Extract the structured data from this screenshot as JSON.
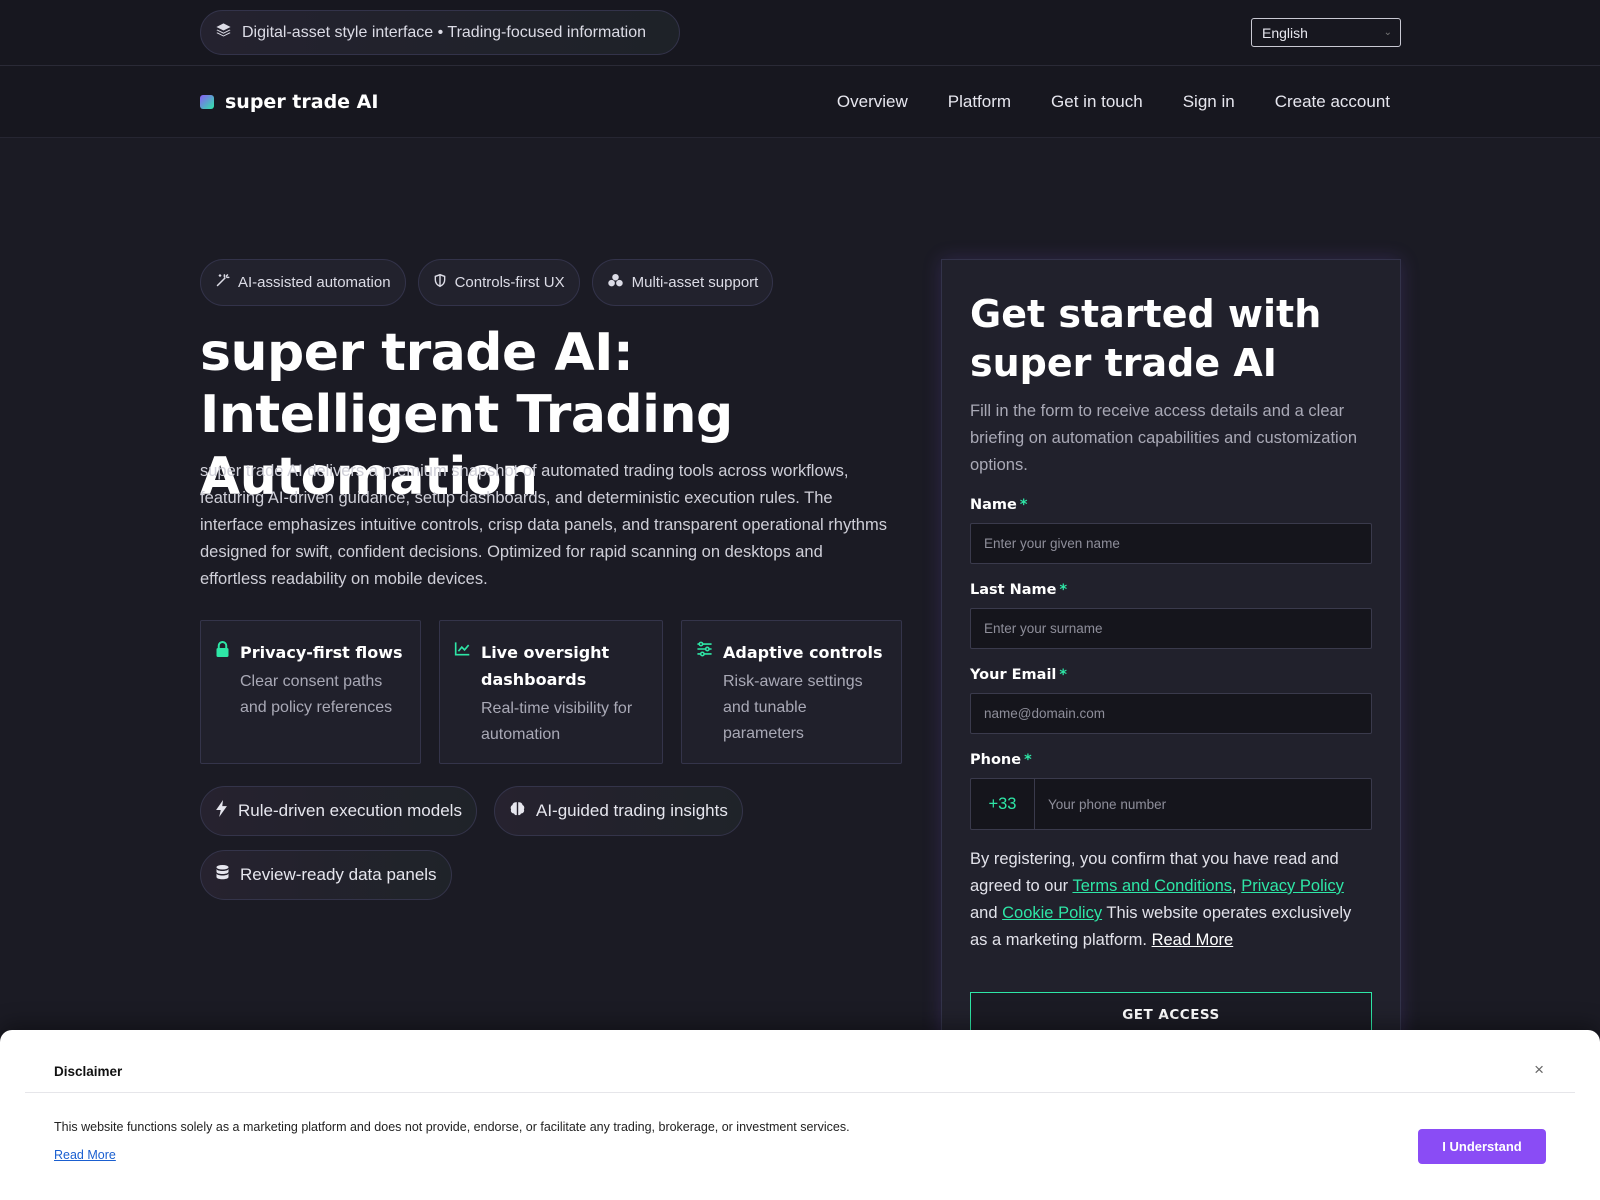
{
  "topbar": {
    "notice": "Digital-asset style interface • Trading-focused information",
    "language": "English"
  },
  "nav": {
    "brand": "super trade AI",
    "links": [
      "Overview",
      "Platform",
      "Get in touch",
      "Sign in",
      "Create account"
    ]
  },
  "hero": {
    "chips": [
      "AI-assisted automation",
      "Controls-first UX",
      "Multi-asset support"
    ],
    "title": "super trade AI: Intelligent Trading Automation",
    "description": "super trade AI delivers a premium snapshot of automated trading tools across workflows, featuring AI-driven guidance, setup dashboards, and deterministic execution rules. The interface emphasizes intuitive controls, crisp data panels, and transparent operational rhythms designed for swift, confident decisions. Optimized for rapid scanning on desktops and effortless readability on mobile devices.",
    "features": [
      {
        "title": "Privacy-first flows",
        "desc": "Clear consent paths and policy references",
        "icon": "lock-icon"
      },
      {
        "title": "Live oversight dashboards",
        "desc": "Real-time visibility for automation",
        "icon": "line-chart-icon"
      },
      {
        "title": "Adaptive controls",
        "desc": "Risk-aware settings and tunable parameters",
        "icon": "sliders-icon"
      }
    ],
    "tags": [
      {
        "label": "Rule-driven execution models",
        "icon": "bolt-icon"
      },
      {
        "label": "AI-guided trading insights",
        "icon": "brain-icon"
      },
      {
        "label": "Review-ready data panels",
        "icon": "database-icon"
      }
    ]
  },
  "form": {
    "title": "Get started with super trade AI",
    "subtitle": "Fill in the form to receive access details and a clear briefing on automation capabilities and customization options.",
    "name_label": "Name",
    "name_placeholder": "Enter your given name",
    "lastname_label": "Last Name",
    "lastname_placeholder": "Enter your surname",
    "email_label": "Your Email",
    "email_placeholder": "name@domain.com",
    "phone_label": "Phone",
    "phone_code": "+33",
    "phone_placeholder": "Your phone number",
    "required_mark": "*",
    "consent_prefix": "By registering, you confirm that you have read and agreed to our",
    "terms": "Terms and Conditions",
    "comma": ",",
    "privacy": "Privacy Policy",
    "and": "and",
    "cookie": "Cookie Policy",
    "consent_suffix": "This website operates exclusively as a marketing platform.",
    "read_more": "Read More",
    "cta": "GET ACCESS"
  },
  "disclaimer": {
    "title": "Disclaimer",
    "close": "×",
    "text": "This website functions solely as a marketing platform and does not provide, endorse, or facilitate any trading, brokerage, or investment services.",
    "read_more": "Read More",
    "button": "I Understand"
  },
  "colors": {
    "background": "#1b1b24",
    "accent_green": "#2ee6a6",
    "accent_purple": "#8a4cf5"
  }
}
